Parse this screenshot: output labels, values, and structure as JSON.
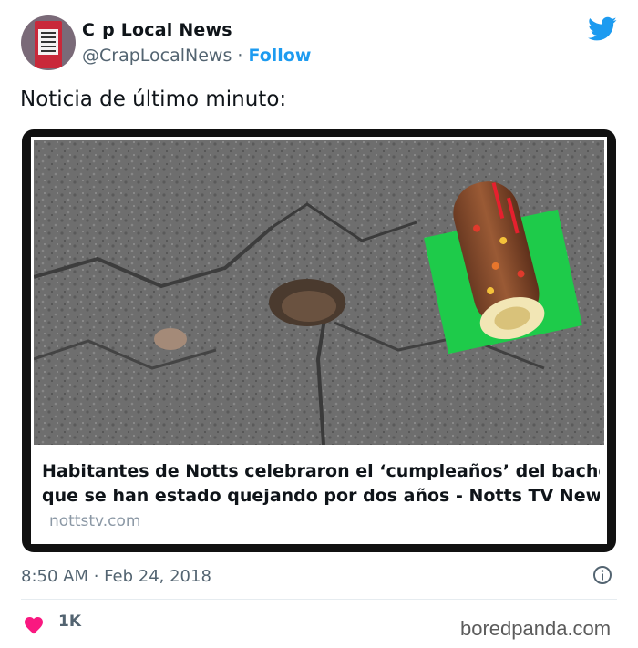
{
  "account": {
    "display_name": "C  p Local News",
    "handle": "@CrapLocalNews",
    "separator": "·",
    "follow_label": "Follow",
    "avatar_icon": "protest-sign-icon"
  },
  "platform_icon": "twitter-bird-icon",
  "tweet": {
    "text": "Noticia de último minuto:",
    "card": {
      "image_description_icon": "pothole-birthday-cake-photo",
      "title_line1": "Habitantes de Notts celebraron el ‘cumpleaños’ del bache del",
      "title_line2": "que se han estado quejando por dos años - Notts TV News | T...",
      "domain": "nottstv.com"
    },
    "timestamp": "8:50 AM · Feb 24, 2018",
    "likes": "1K"
  },
  "watermark": "boredpanda.com",
  "colors": {
    "accent": "#1d9bf0",
    "heart": "#f91880",
    "muted_text": "#536471"
  }
}
